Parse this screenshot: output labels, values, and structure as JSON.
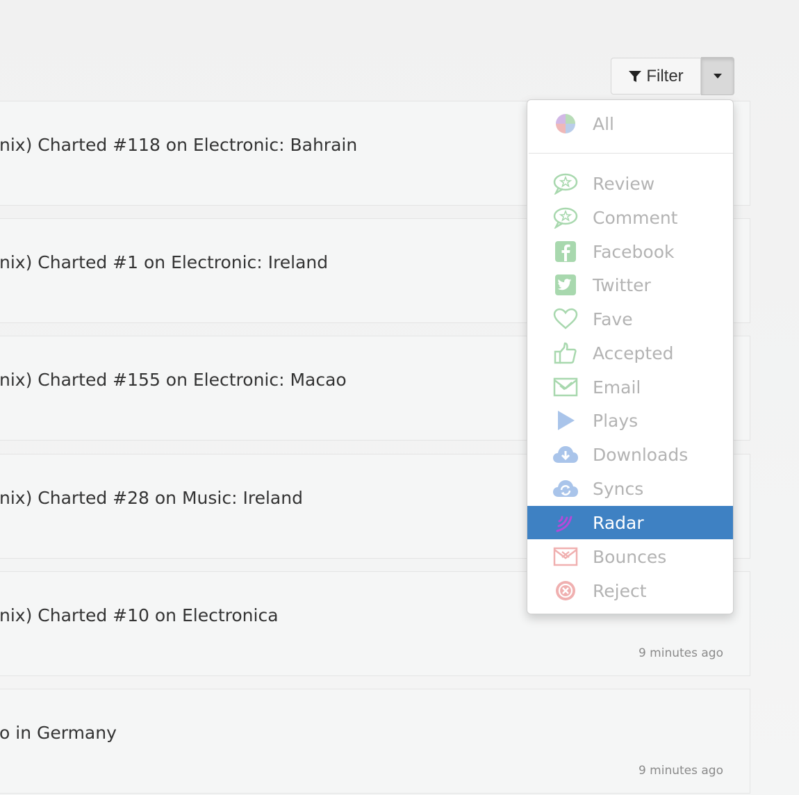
{
  "toolbar": {
    "filter_label": "Filter"
  },
  "feed": [
    {
      "title": "nix) Charted #118 on Electronic: Bahrain",
      "time": ""
    },
    {
      "title": "nix) Charted #1 on Electronic: Ireland",
      "time": ""
    },
    {
      "title": "nix) Charted #155 on Electronic: Macao",
      "time": ""
    },
    {
      "title": "nix) Charted #28 on Music: Ireland",
      "time": ""
    },
    {
      "title": "nix) Charted #10 on Electronica",
      "time": "9 minutes ago"
    },
    {
      "title": "o in Germany",
      "time": "9 minutes ago"
    }
  ],
  "filter_menu": {
    "items": [
      {
        "label": "All",
        "icon": "all-icon",
        "color": "#c9a6d8"
      },
      {
        "label": "Review",
        "icon": "review-icon",
        "color": "#a8d8ae"
      },
      {
        "label": "Comment",
        "icon": "comment-icon",
        "color": "#a8d8ae"
      },
      {
        "label": "Facebook",
        "icon": "facebook-icon",
        "color": "#a8d8ae"
      },
      {
        "label": "Twitter",
        "icon": "twitter-icon",
        "color": "#a8d8ae"
      },
      {
        "label": "Fave",
        "icon": "heart-icon",
        "color": "#a8d8ae"
      },
      {
        "label": "Accepted",
        "icon": "thumbs-up-icon",
        "color": "#a8d8ae"
      },
      {
        "label": "Email",
        "icon": "email-icon",
        "color": "#a8d8ae"
      },
      {
        "label": "Plays",
        "icon": "play-icon",
        "color": "#a9c4ea"
      },
      {
        "label": "Downloads",
        "icon": "cloud-download-icon",
        "color": "#a9c4ea"
      },
      {
        "label": "Syncs",
        "icon": "cloud-sync-icon",
        "color": "#a9c4ea"
      },
      {
        "label": "Radar",
        "icon": "radar-icon",
        "color": "#b44ad8",
        "active": true
      },
      {
        "label": "Bounces",
        "icon": "bounce-email-icon",
        "color": "#f0b0b0"
      },
      {
        "label": "Reject",
        "icon": "reject-icon",
        "color": "#f0b0b0"
      }
    ]
  }
}
